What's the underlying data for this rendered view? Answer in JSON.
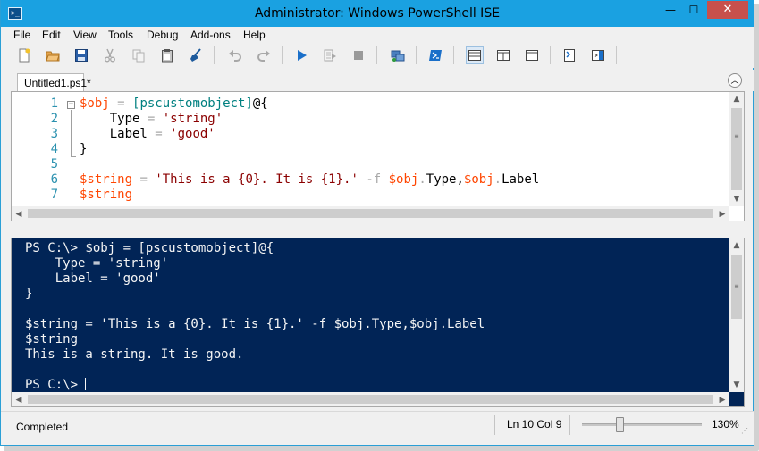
{
  "window": {
    "title": "Administrator: Windows PowerShell ISE",
    "icon_label": ">_",
    "controls": {
      "minimize": "—",
      "maximize": "☐",
      "close": "✕"
    }
  },
  "menu": [
    "File",
    "Edit",
    "View",
    "Tools",
    "Debug",
    "Add-ons",
    "Help"
  ],
  "toolbar": {
    "buttons": [
      {
        "name": "new-script-icon",
        "icon": "new-document",
        "enabled": true
      },
      {
        "name": "open-script-icon",
        "icon": "open-folder",
        "enabled": true
      },
      {
        "name": "save-script-icon",
        "icon": "floppy-disk",
        "enabled": true
      },
      {
        "name": "cut-icon",
        "icon": "scissors",
        "enabled": false
      },
      {
        "name": "copy-icon",
        "icon": "copy",
        "enabled": false
      },
      {
        "name": "paste-icon",
        "icon": "clipboard",
        "enabled": true
      },
      {
        "name": "clear-console-icon",
        "icon": "broom",
        "enabled": true
      },
      {
        "name": "undo-icon",
        "icon": "undo-arrow",
        "enabled": false
      },
      {
        "name": "redo-icon",
        "icon": "redo-arrow",
        "enabled": false
      },
      {
        "name": "run-script-icon",
        "icon": "play-triangle",
        "enabled": true
      },
      {
        "name": "run-selection-icon",
        "icon": "run-selection",
        "enabled": false
      },
      {
        "name": "stop-operation-icon",
        "icon": "stop-square",
        "enabled": false
      },
      {
        "name": "remote-powershell-icon",
        "icon": "remote-tab",
        "enabled": true
      },
      {
        "name": "start-powershell-icon",
        "icon": "powershell-window",
        "enabled": true
      },
      {
        "name": "script-pane-top-icon",
        "icon": "layout-top",
        "enabled": true
      },
      {
        "name": "script-pane-right-icon",
        "icon": "layout-right",
        "enabled": true
      },
      {
        "name": "script-pane-maximized-icon",
        "icon": "layout-max",
        "enabled": true
      },
      {
        "name": "show-command-window-icon",
        "icon": "command-window",
        "enabled": true
      },
      {
        "name": "show-command-addon-icon",
        "icon": "command-addon",
        "enabled": true
      }
    ],
    "accent": "#1a6fc9"
  },
  "tabs": [
    {
      "label": "Untitled1.ps1*",
      "active": true
    }
  ],
  "editor": {
    "line_numbers": [
      "1",
      "2",
      "3",
      "4",
      "5",
      "6",
      "7"
    ],
    "lines": [
      [
        {
          "t": "$obj",
          "c": "var"
        },
        {
          "t": " = ",
          "c": "op"
        },
        {
          "t": "[pscustomobject]",
          "c": "type"
        },
        {
          "t": "@{",
          "c": "plain"
        }
      ],
      [
        {
          "t": "    Type",
          "c": "prop"
        },
        {
          "t": " = ",
          "c": "op"
        },
        {
          "t": "'string'",
          "c": "str"
        }
      ],
      [
        {
          "t": "    Label",
          "c": "prop"
        },
        {
          "t": " = ",
          "c": "op"
        },
        {
          "t": "'good'",
          "c": "str"
        }
      ],
      [
        {
          "t": "}",
          "c": "plain"
        }
      ],
      [],
      [
        {
          "t": "$string",
          "c": "var"
        },
        {
          "t": " = ",
          "c": "op"
        },
        {
          "t": "'This is a {0}. It is {1}.'",
          "c": "str"
        },
        {
          "t": " -f ",
          "c": "op"
        },
        {
          "t": "$obj",
          "c": "var"
        },
        {
          "t": ".",
          "c": "op"
        },
        {
          "t": "Type",
          "c": "prop"
        },
        {
          "t": ",",
          "c": "plain"
        },
        {
          "t": "$obj",
          "c": "var"
        },
        {
          "t": ".",
          "c": "op"
        },
        {
          "t": "Label",
          "c": "prop"
        }
      ],
      [
        {
          "t": "$string",
          "c": "var"
        }
      ]
    ],
    "colors": {
      "var": "#ff4500",
      "type": "#008080",
      "op": "#a9a9a9",
      "str": "#8b0000",
      "line_number": "#2b91af"
    }
  },
  "console": {
    "background": "#012456",
    "lines": [
      "PS C:\\> $obj = [pscustomobject]@{",
      "    Type = 'string'",
      "    Label = 'good'",
      "}",
      "",
      "$string = 'This is a {0}. It is {1}.' -f $obj.Type,$obj.Label",
      "$string",
      "This is a string. It is good.",
      "",
      "PS C:\\> "
    ]
  },
  "status": {
    "text": "Completed",
    "position": "Ln 10  Col 9",
    "zoom": "130%",
    "zoom_level": 0.3
  }
}
